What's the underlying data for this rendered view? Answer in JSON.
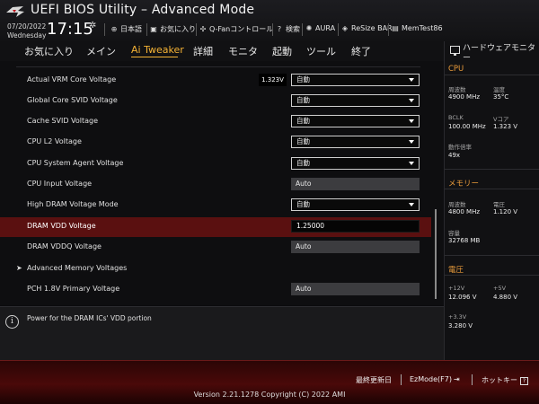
{
  "header": {
    "title": "UEFI BIOS Utility – Advanced Mode",
    "date": "07/20/2022",
    "day": "Wednesday",
    "time": "17:15",
    "toolbar": [
      {
        "icon": "globe-icon",
        "label": "日本語"
      },
      {
        "icon": "star-icon",
        "label": "お気に入り"
      },
      {
        "icon": "fan-icon",
        "label": "Q-Fanコントロール"
      },
      {
        "icon": "help-icon",
        "label": "検索"
      },
      {
        "icon": "aura-icon",
        "label": "AURA"
      },
      {
        "icon": "resize-bar-icon",
        "label": "ReSize BAR"
      },
      {
        "icon": "memtest-icon",
        "label": "MemTest86"
      }
    ]
  },
  "tabs": [
    {
      "label": "お気に入り",
      "active": false
    },
    {
      "label": "メイン",
      "active": false
    },
    {
      "label": "Ai Tweaker",
      "active": true
    },
    {
      "label": "詳細",
      "active": false
    },
    {
      "label": "モニタ",
      "active": false
    },
    {
      "label": "起動",
      "active": false
    },
    {
      "label": "ツール",
      "active": false
    },
    {
      "label": "終了",
      "active": false
    }
  ],
  "settings": [
    {
      "label": "Actual VRM Core Voltage",
      "badge": "1.323V",
      "value": "自動",
      "kind": "dropdown"
    },
    {
      "label": "Global Core SVID Voltage",
      "value": "自動",
      "kind": "dropdown"
    },
    {
      "label": "Cache SVID Voltage",
      "value": "自動",
      "kind": "dropdown"
    },
    {
      "label": "CPU L2 Voltage",
      "value": "自動",
      "kind": "dropdown"
    },
    {
      "label": "CPU System Agent Voltage",
      "value": "自動",
      "kind": "dropdown"
    },
    {
      "label": "CPU Input Voltage",
      "value": "Auto",
      "kind": "readonly"
    },
    {
      "label": "High DRAM Voltage Mode",
      "value": "自動",
      "kind": "dropdown"
    },
    {
      "label": "DRAM VDD Voltage",
      "value": "1.25000",
      "kind": "input",
      "selected": true
    },
    {
      "label": "DRAM VDDQ Voltage",
      "value": "Auto",
      "kind": "readonly"
    },
    {
      "label": "Advanced Memory Voltages",
      "kind": "submenu"
    },
    {
      "label": "PCH 1.8V Primary Voltage",
      "value": "Auto",
      "kind": "readonly"
    }
  ],
  "help": {
    "text": "Power for the DRAM ICs' VDD portion"
  },
  "hardware_monitor": {
    "title": "ハードウェアモニター",
    "cpu": {
      "section": "CPU",
      "freq_label": "周波数",
      "freq_value": "4900 MHz",
      "temp_label": "温度",
      "temp_value": "35°C",
      "bclk_label": "BCLK",
      "bclk_value": "100.00 MHz",
      "vcore_label": "Vコア",
      "vcore_value": "1.323 V",
      "ratio_label": "動作倍率",
      "ratio_value": "49x"
    },
    "memory": {
      "section": "メモリー",
      "freq_label": "周波数",
      "freq_value": "4800 MHz",
      "volt_label": "電圧",
      "volt_value": "1.120 V",
      "cap_label": "容量",
      "cap_value": "32768 MB"
    },
    "voltage": {
      "section": "電圧",
      "v12_label": "+12V",
      "v12_value": "12.096 V",
      "v5_label": "+5V",
      "v5_value": "4.880 V",
      "v33_label": "+3.3V",
      "v33_value": "3.280 V"
    }
  },
  "footer": {
    "last_modified": "最終更新日",
    "ezmode": "EzMode(F7)",
    "hotkeys": "ホットキー",
    "version": "Version 2.21.1278 Copyright (C) 2022 AMI"
  },
  "colors": {
    "accent": "#f5b335",
    "selected_row": "#5a1010",
    "section": "#e89a3a"
  }
}
